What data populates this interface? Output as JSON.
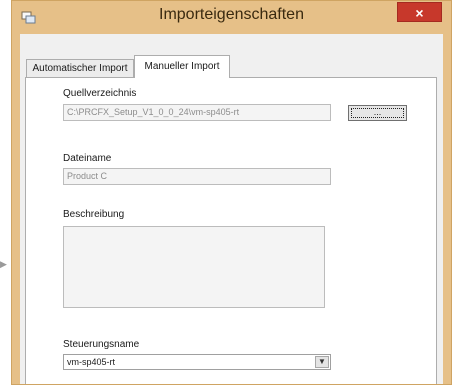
{
  "window": {
    "title": "Importeigenschaften",
    "close_label": "×"
  },
  "tabs": [
    {
      "label": "Automatischer Import",
      "active": false
    },
    {
      "label": "Manueller Import",
      "active": true
    }
  ],
  "form": {
    "source_dir_label": "Quellverzeichnis",
    "source_dir_value": "C:\\PRCFX_Setup_V1_0_0_24\\vm-sp405-rt",
    "browse_label": "...",
    "filename_label": "Dateiname",
    "filename_value": "Product C",
    "description_label": "Beschreibung",
    "description_value": "",
    "control_name_label": "Steuerungsname",
    "control_name_value": "vm-sp405-rt"
  },
  "colors": {
    "frame": "#e6c088",
    "close": "#c7382b",
    "client": "#f0f0f0"
  }
}
